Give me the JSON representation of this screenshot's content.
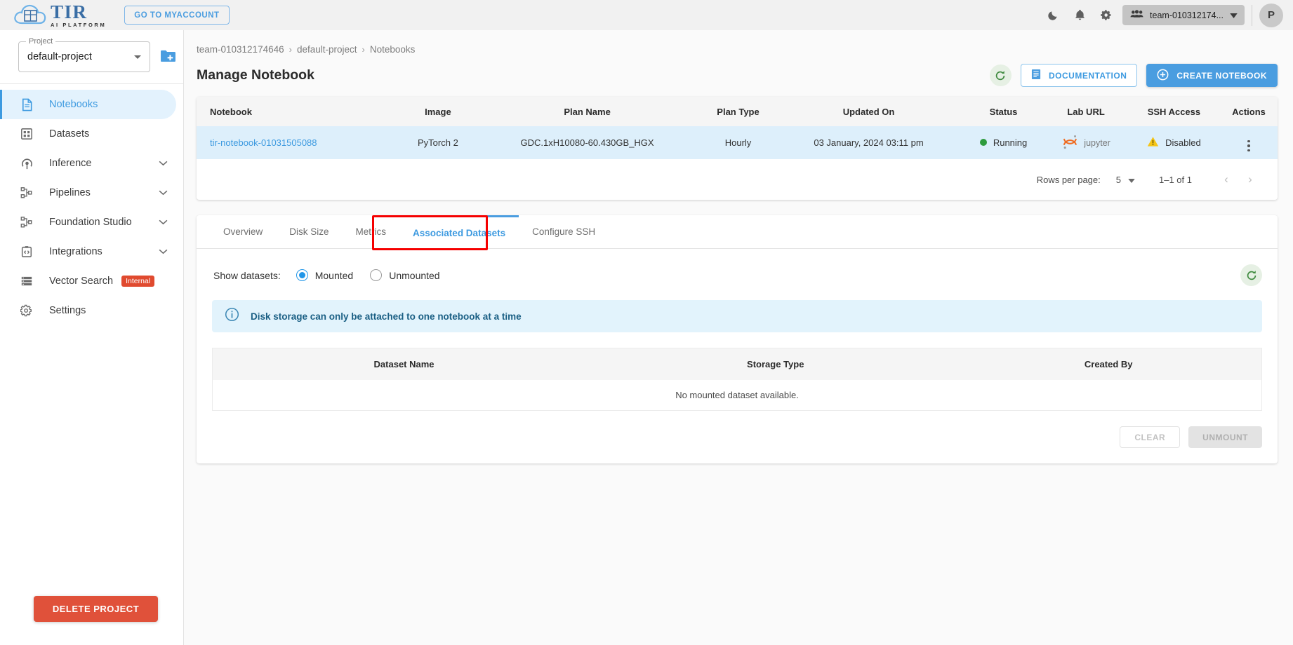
{
  "header": {
    "logo_title": "TIR",
    "logo_subtitle": "AI PLATFORM",
    "myaccount_label": "GO TO MYACCOUNT",
    "dark_mode_icon": "moon-icon",
    "notifications_icon": "bell-icon",
    "settings_icon": "gear-icon",
    "team_name": "team-010312174...",
    "avatar_initial": "P"
  },
  "sidebar": {
    "project_legend": "Project",
    "project_value": "default-project",
    "add_project_icon": "add-folder-icon",
    "items": [
      {
        "label": "Notebooks",
        "icon": "document-icon",
        "active": true,
        "expandable": false
      },
      {
        "label": "Datasets",
        "icon": "grid-icon",
        "active": false,
        "expandable": false
      },
      {
        "label": "Inference",
        "icon": "inference-icon",
        "active": false,
        "expandable": true
      },
      {
        "label": "Pipelines",
        "icon": "pipeline-icon",
        "active": false,
        "expandable": true
      },
      {
        "label": "Foundation Studio",
        "icon": "pipeline-icon",
        "active": false,
        "expandable": true
      },
      {
        "label": "Integrations",
        "icon": "code-clipboard-icon",
        "active": false,
        "expandable": true
      },
      {
        "label": "Vector Search",
        "icon": "list-icon",
        "active": false,
        "expandable": false,
        "badge": "Internal"
      },
      {
        "label": "Settings",
        "icon": "gear-icon",
        "active": false,
        "expandable": false
      }
    ],
    "delete_project_label": "DELETE PROJECT"
  },
  "breadcrumb": {
    "items": [
      "team-010312174646",
      "default-project",
      "Notebooks"
    ],
    "separator": "›"
  },
  "page": {
    "title": "Manage Notebook",
    "refresh_icon": "refresh-icon",
    "documentation_label": "DOCUMENTATION",
    "documentation_icon": "book-icon",
    "create_label": "CREATE NOTEBOOK",
    "create_icon": "plus-circle-icon"
  },
  "notebook_table": {
    "columns": [
      "Notebook",
      "Image",
      "Plan Name",
      "Plan Type",
      "Updated On",
      "Status",
      "Lab URL",
      "SSH Access",
      "Actions"
    ],
    "rows": [
      {
        "notebook": "tir-notebook-01031505088",
        "image": "PyTorch 2",
        "plan_name": "GDC.1xH10080-60.430GB_HGX",
        "plan_type": "Hourly",
        "updated_on": "03 January, 2024 03:11 pm",
        "status": "Running",
        "status_color": "#2e9b3d",
        "lab_url": "jupyter",
        "ssh_access": "Disabled",
        "ssh_icon": "warning-triangle-icon",
        "actions_icon": "kebab-menu-icon"
      }
    ]
  },
  "pagination": {
    "rows_per_page_label": "Rows per page:",
    "rows_per_page_value": "5",
    "range_label": "1–1 of 1",
    "prev_icon": "chevron-left-icon",
    "next_icon": "chevron-right-icon"
  },
  "tabs": [
    {
      "label": "Overview",
      "active": false
    },
    {
      "label": "Disk Size",
      "active": false
    },
    {
      "label": "Metrics",
      "active": false
    },
    {
      "label": "Associated Datasets",
      "active": true,
      "highlighted": true
    },
    {
      "label": "Configure SSH",
      "active": false
    }
  ],
  "highlight_color": "#f50000",
  "datasets_panel": {
    "show_label": "Show datasets:",
    "options": [
      {
        "label": "Mounted",
        "selected": true
      },
      {
        "label": "Unmounted",
        "selected": false
      }
    ],
    "refresh_icon": "refresh-icon",
    "info_icon": "info-icon",
    "info_message": "Disk storage can only be attached to one notebook at a time",
    "table_columns": [
      "Dataset Name",
      "Storage Type",
      "Created By"
    ],
    "empty_message": "No mounted dataset available.",
    "clear_label": "CLEAR",
    "unmount_label": "UNMOUNT"
  }
}
